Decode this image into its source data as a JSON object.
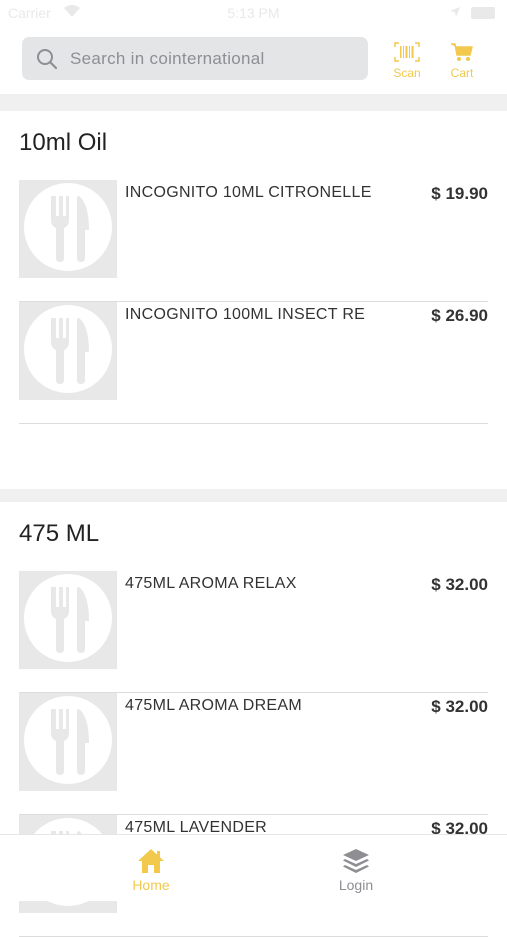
{
  "status_bar": {
    "carrier": "Carrier",
    "time": "5:13 PM"
  },
  "search": {
    "placeholder": "Search in cointernational"
  },
  "header_buttons": {
    "scan_label": "Scan",
    "cart_label": "Cart"
  },
  "colors": {
    "accent": "#f2c94c",
    "inactive": "#8e8e93",
    "search_bg": "#e4e5e7"
  },
  "sections": [
    {
      "title": "10ml Oil",
      "items": [
        {
          "name": "INCOGNITO 10ML CITRONELLE",
          "price": "$ 19.90",
          "icon": "cutlery-icon"
        },
        {
          "name": "INCOGNITO 100ML INSECT RE",
          "price": "$ 26.90",
          "icon": "cutlery-icon"
        }
      ]
    },
    {
      "title": "475 ML",
      "items": [
        {
          "name": "475ML AROMA RELAX",
          "price": "$ 32.00",
          "icon": "cutlery-icon"
        },
        {
          "name": "475ML AROMA DREAM",
          "price": "$ 32.00",
          "icon": "cutlery-icon"
        },
        {
          "name": "475ML LAVENDER",
          "price": "$ 32.00",
          "icon": "cutlery-icon"
        }
      ]
    }
  ],
  "tab_bar": {
    "home_label": "Home",
    "login_label": "Login"
  }
}
